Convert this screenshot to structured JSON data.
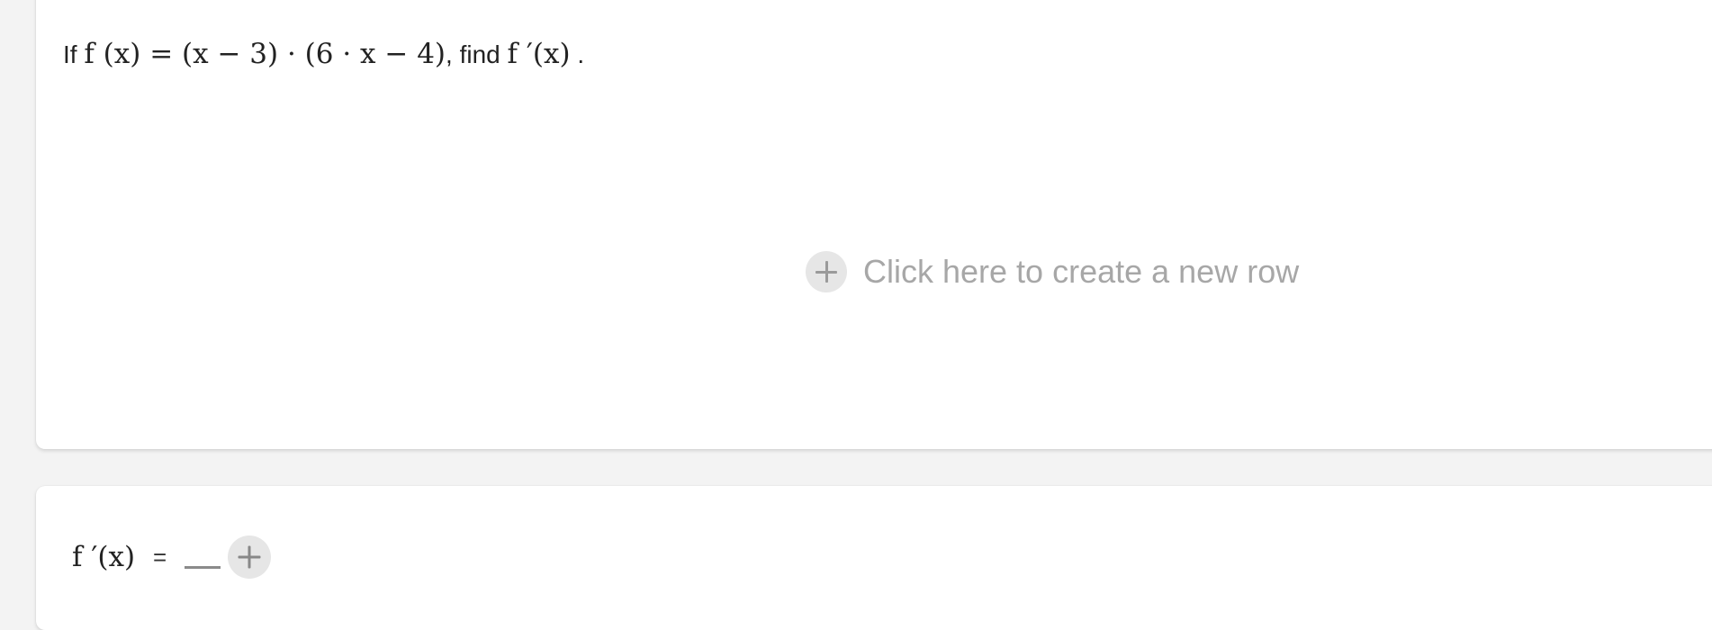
{
  "question": {
    "prefix": "If",
    "function_def": "f (x) = (x − 3) · (6 · x − 4)",
    "middle": ", find",
    "target": "f ′(x)",
    "suffix": "."
  },
  "new_row": {
    "label": "Click here to create a new row",
    "icon": "plus-icon"
  },
  "answer": {
    "lhs": "f ′(x)",
    "equals": "=",
    "value": "",
    "add_icon": "plus-icon"
  },
  "colors": {
    "background": "#f3f3f3",
    "card": "#ffffff",
    "muted_text": "#a7a7a7",
    "icon_circle": "#e6e6e6"
  }
}
